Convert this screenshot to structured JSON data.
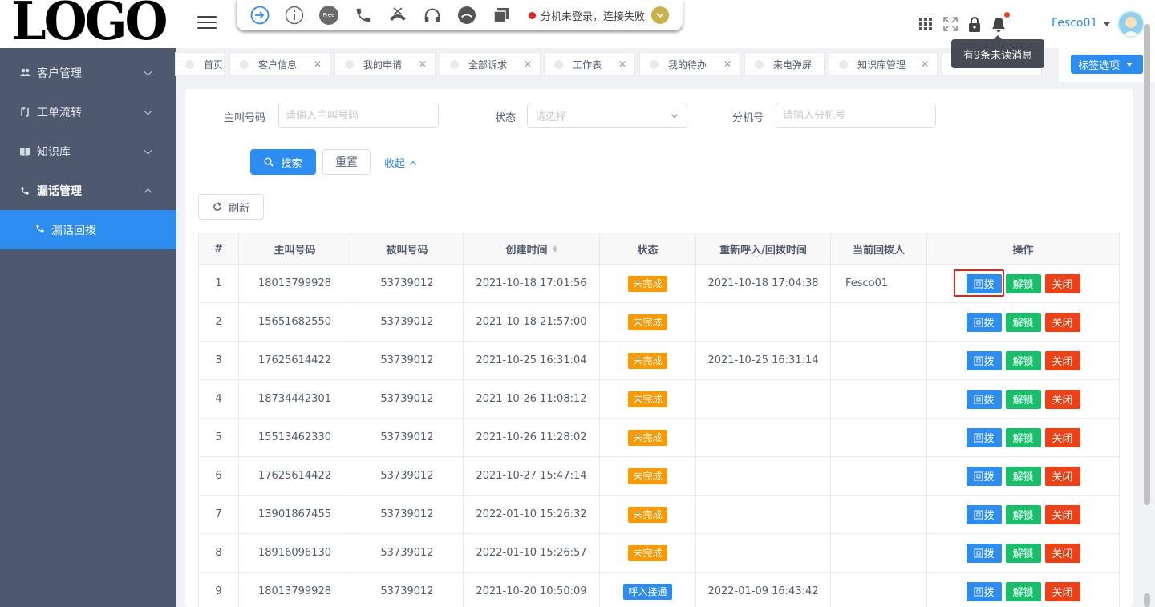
{
  "logo": {
    "text": "LOGO"
  },
  "sidebar": {
    "items": [
      {
        "label": "客户管理",
        "icon": "users-icon",
        "expanded": false
      },
      {
        "label": "工单流转",
        "icon": "workflow-icon",
        "expanded": false
      },
      {
        "label": "知识库",
        "icon": "book-icon",
        "expanded": false
      },
      {
        "label": "漏话管理",
        "icon": "phone-icon",
        "expanded": true
      }
    ],
    "sub_items": [
      {
        "label": "漏话回拨",
        "icon": "phone-icon",
        "active": true
      }
    ]
  },
  "phonebar": {
    "icons": [
      "sign-in-icon",
      "info-icon",
      "free-icon",
      "phone-icon",
      "hangup-icon",
      "headset-icon",
      "hold-icon",
      "copy-icon"
    ],
    "free_label": "Free",
    "status_text": "分机未登录，连接失败",
    "status_color": "#e1251b"
  },
  "header": {
    "user_name": "Fesco01",
    "notification_tooltip": "有9条未读消息",
    "icons": [
      "apps-icon",
      "fullscreen-icon",
      "lock-icon",
      "bell-icon"
    ]
  },
  "tabs": [
    {
      "label": "首页",
      "closable": false
    },
    {
      "label": "客户信息",
      "closable": true
    },
    {
      "label": "我的申请",
      "closable": true
    },
    {
      "label": "全部诉求",
      "closable": true
    },
    {
      "label": "工作表",
      "closable": true
    },
    {
      "label": "我的待办",
      "closable": true
    },
    {
      "label": "来电弹屏",
      "closable": true
    },
    {
      "label": "知识库管理",
      "closable": true
    }
  ],
  "tab_options_label": "标签选项",
  "filters": {
    "caller": {
      "label": "主叫号码",
      "placeholder": "请输入主叫号码"
    },
    "status": {
      "label": "状态",
      "placeholder": "请选择"
    },
    "extension": {
      "label": "分机号",
      "placeholder": "请输入分机号"
    }
  },
  "actions": {
    "search": "搜索",
    "reset": "重置",
    "collapse": "收起",
    "refresh": "刷新"
  },
  "table": {
    "headers": [
      "#",
      "主叫号码",
      "被叫号码",
      "创建时间",
      "状态",
      "重新呼入/回拨时间",
      "当前回拨人",
      "操作"
    ],
    "op_labels": {
      "callback": "回拨",
      "unlock": "解锁",
      "close": "关闭"
    },
    "rows": [
      {
        "no": "1",
        "caller": "18013799928",
        "callee": "53739012",
        "created": "2021-10-18 17:01:56",
        "status": "未完成",
        "status_color": "#ff9900",
        "recall": "2021-10-18 17:04:38",
        "handler": "Fesco01"
      },
      {
        "no": "2",
        "caller": "15651682550",
        "callee": "53739012",
        "created": "2021-10-18 21:57:00",
        "status": "未完成",
        "status_color": "#ff9900",
        "recall": "",
        "handler": ""
      },
      {
        "no": "3",
        "caller": "17625614422",
        "callee": "53739012",
        "created": "2021-10-25 16:31:04",
        "status": "未完成",
        "status_color": "#ff9900",
        "recall": "2021-10-25 16:31:14",
        "handler": ""
      },
      {
        "no": "4",
        "caller": "18734442301",
        "callee": "53739012",
        "created": "2021-10-26 11:08:12",
        "status": "未完成",
        "status_color": "#ff9900",
        "recall": "",
        "handler": ""
      },
      {
        "no": "5",
        "caller": "15513462330",
        "callee": "53739012",
        "created": "2021-10-26 11:28:02",
        "status": "未完成",
        "status_color": "#ff9900",
        "recall": "",
        "handler": ""
      },
      {
        "no": "6",
        "caller": "17625614422",
        "callee": "53739012",
        "created": "2021-10-27 15:47:14",
        "status": "未完成",
        "status_color": "#ff9900",
        "recall": "",
        "handler": ""
      },
      {
        "no": "7",
        "caller": "13901867455",
        "callee": "53739012",
        "created": "2022-01-10 15:26:32",
        "status": "未完成",
        "status_color": "#ff9900",
        "recall": "",
        "handler": ""
      },
      {
        "no": "8",
        "caller": "18916096130",
        "callee": "53739012",
        "created": "2022-01-10 15:26:57",
        "status": "未完成",
        "status_color": "#ff9900",
        "recall": "",
        "handler": ""
      },
      {
        "no": "9",
        "caller": "18013799928",
        "callee": "53739012",
        "created": "2021-10-20 10:50:09",
        "status": "呼入接通",
        "status_color": "#2d8cf0",
        "recall": "2022-01-09 16:43:42",
        "handler": ""
      }
    ]
  },
  "colors": {
    "primary": "#2d8cf0",
    "success": "#19be6b",
    "danger": "#ed4014",
    "warning": "#ff9900",
    "sidebar": "#4e596f"
  }
}
